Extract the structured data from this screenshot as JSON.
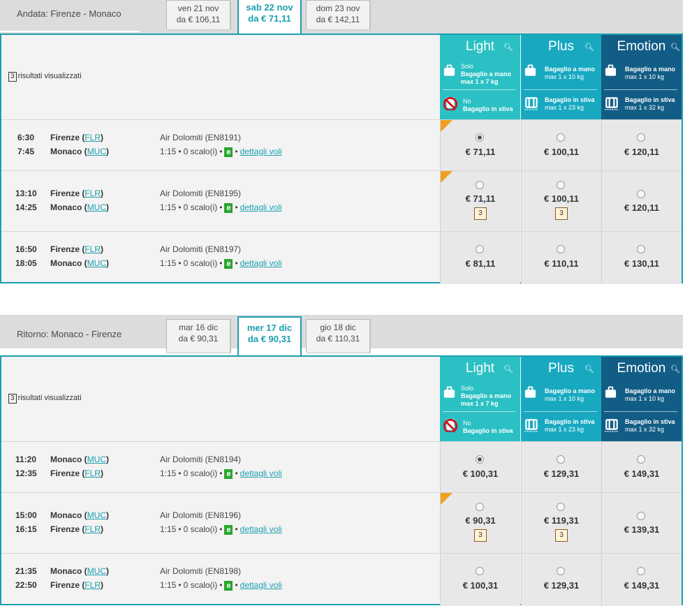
{
  "outbound": {
    "route": "Andata: Firenze - Monaco",
    "tabs": [
      {
        "day": "ven 21 nov",
        "price": "da € 106,11",
        "active": false
      },
      {
        "day": "sab 22 nov",
        "price": "da € 71,11",
        "active": true
      },
      {
        "day": "dom 23 nov",
        "price": "da € 142,11",
        "active": false
      }
    ],
    "results_count": "3",
    "results_label": "risultati visualizzati",
    "rows": [
      {
        "dep_time": "6:30",
        "arr_time": "7:45",
        "from_city": "Firenze",
        "from_code": "FLR",
        "to_city": "Monaco",
        "to_code": "MUC",
        "flight": "Air Dolomiti (EN8191)",
        "duration": "1:15",
        "stops": "0 scalo(i)",
        "light": "€ 71,11",
        "plus": "€ 100,11",
        "emotion": "€ 120,11",
        "selected": "light",
        "promo": true,
        "seat": false
      },
      {
        "dep_time": "13:10",
        "arr_time": "14:25",
        "from_city": "Firenze",
        "from_code": "FLR",
        "to_city": "Monaco",
        "to_code": "MUC",
        "flight": "Air Dolomiti (EN8195)",
        "duration": "1:15",
        "stops": "0 scalo(i)",
        "light": "€ 71,11",
        "plus": "€ 100,11",
        "emotion": "€ 120,11",
        "selected": "",
        "promo": true,
        "seat": true
      },
      {
        "dep_time": "16:50",
        "arr_time": "18:05",
        "from_city": "Firenze",
        "from_code": "FLR",
        "to_city": "Monaco",
        "to_code": "MUC",
        "flight": "Air Dolomiti (EN8197)",
        "duration": "1:15",
        "stops": "0 scalo(i)",
        "light": "€ 81,11",
        "plus": "€ 110,11",
        "emotion": "€ 130,11",
        "selected": "",
        "promo": false,
        "seat": false
      }
    ]
  },
  "return": {
    "route": "Ritorno: Monaco - Firenze",
    "tabs": [
      {
        "day": "mar 16 dic",
        "price": "da € 90,31",
        "active": false
      },
      {
        "day": "mer 17 dic",
        "price": "da € 90,31",
        "active": true
      },
      {
        "day": "gio 18 dic",
        "price": "da € 110,31",
        "active": false
      }
    ],
    "results_count": "3",
    "results_label": "risultati visualizzati",
    "rows": [
      {
        "dep_time": "11:20",
        "arr_time": "12:35",
        "from_city": "Monaco",
        "from_code": "MUC",
        "to_city": "Firenze",
        "to_code": "FLR",
        "flight": "Air Dolomiti (EN8194)",
        "duration": "1:15",
        "stops": "0 scalo(i)",
        "light": "€ 100,31",
        "plus": "€ 129,31",
        "emotion": "€ 149,31",
        "selected": "light",
        "promo": false,
        "seat": false
      },
      {
        "dep_time": "15:00",
        "arr_time": "16:15",
        "from_city": "Monaco",
        "from_code": "MUC",
        "to_city": "Firenze",
        "to_code": "FLR",
        "flight": "Air Dolomiti (EN8196)",
        "duration": "1:15",
        "stops": "0 scalo(i)",
        "light": "€ 90,31",
        "plus": "€ 119,31",
        "emotion": "€ 139,31",
        "selected": "",
        "promo": true,
        "seat": true
      },
      {
        "dep_time": "21:35",
        "arr_time": "22:50",
        "from_city": "Monaco",
        "from_code": "MUC",
        "to_city": "Firenze",
        "to_code": "FLR",
        "flight": "Air Dolomiti (EN8198)",
        "duration": "1:15",
        "stops": "0 scalo(i)",
        "light": "€ 100,31",
        "plus": "€ 129,31",
        "emotion": "€ 149,31",
        "selected": "",
        "promo": false,
        "seat": false
      }
    ]
  },
  "fares": {
    "light": {
      "name": "Light",
      "hand_a": "Solo",
      "hand_b": "Bagaglio a mano",
      "hand_c": "max 1 x 7 kg",
      "hold_a": "No",
      "hold_b": "Bagaglio in stiva"
    },
    "plus": {
      "name": "Plus",
      "hand_b": "Bagaglio a mano",
      "hand_c": "max 1 x 10 kg",
      "hold_b": "Bagaglio in stiva",
      "hold_c": "max 1 x 23 kg"
    },
    "emotion": {
      "name": "Emotion",
      "hand_b": "Bagaglio a mano",
      "hand_c": "max 1 x 10 kg",
      "hold_b": "Bagaglio in stiva",
      "hold_c": "max 1 x 32 kg"
    }
  },
  "labels": {
    "details_link": "dettagli voli",
    "e_badge": "e",
    "seat_badge": "3"
  },
  "colors": {
    "accent": "#1a9fb0",
    "light": "#2bc0c4",
    "plus": "#18a9c1",
    "emotion": "#125d86",
    "promo_corner": "#f0a020",
    "e_badge": "#2aa52f"
  },
  "icons": {
    "search": "magnifier-icon",
    "hand_bag": "hand-luggage-icon",
    "hold_bag": "hold-luggage-icon",
    "no_hold": "no-luggage-icon",
    "seat": "seat-icon"
  }
}
